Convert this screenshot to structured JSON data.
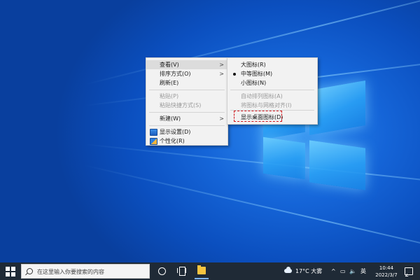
{
  "context_menu": {
    "items": [
      {
        "label": "查看(V)"
      },
      {
        "label": "排序方式(O)"
      },
      {
        "label": "刷新(E)"
      },
      {
        "label": "粘贴(P)"
      },
      {
        "label": "粘贴快捷方式(S)"
      },
      {
        "label": "新建(W)"
      },
      {
        "label": "显示设置(D)"
      },
      {
        "label": "个性化(R)"
      }
    ]
  },
  "view_submenu": {
    "items": [
      {
        "label": "大图标(R)"
      },
      {
        "label": "中等图标(M)"
      },
      {
        "label": "小图标(N)"
      },
      {
        "label": "自动排列图标(A)"
      },
      {
        "label": "将图标与网格对齐(I)"
      },
      {
        "label": "显示桌面图标(D)"
      }
    ]
  },
  "taskbar": {
    "search_placeholder": "在这里输入你要搜索的内容",
    "weather": "17°C 大雾",
    "input_method": "英",
    "time": "10:44",
    "date": "2022/3/7"
  },
  "colors": {
    "highlight_dash": "#d0141b",
    "taskbar_bg": "#1f2a36",
    "desktop_blue": "#1565d8"
  }
}
